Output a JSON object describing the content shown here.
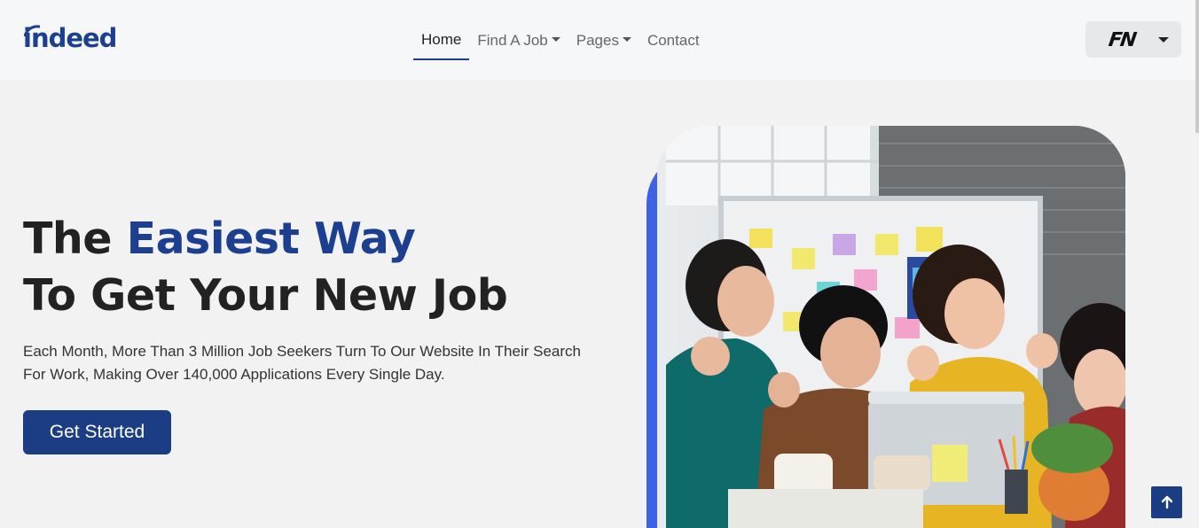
{
  "brand": {
    "logo_text": "indeed",
    "accent_color": "#1d3f8f"
  },
  "nav": {
    "items": [
      {
        "label": "Home",
        "active": true,
        "dropdown": false
      },
      {
        "label": "Find A Job",
        "active": false,
        "dropdown": true
      },
      {
        "label": "Pages",
        "active": false,
        "dropdown": true
      },
      {
        "label": "Contact",
        "active": false,
        "dropdown": false
      }
    ]
  },
  "profile": {
    "initials": "FN"
  },
  "hero": {
    "title_line1_plain": "The ",
    "title_line1_accent": "Easiest Way",
    "title_line2": "To Get Your New Job",
    "description": "Each Month, More Than 3 Million Job Seekers Turn To Our Website In Their Search For Work, Making Over 140,000 Applications Every Single Day.",
    "cta_label": "Get Started"
  },
  "icons": {
    "back_to_top": "arrow-up-icon",
    "dropdown": "caret-down-icon"
  }
}
